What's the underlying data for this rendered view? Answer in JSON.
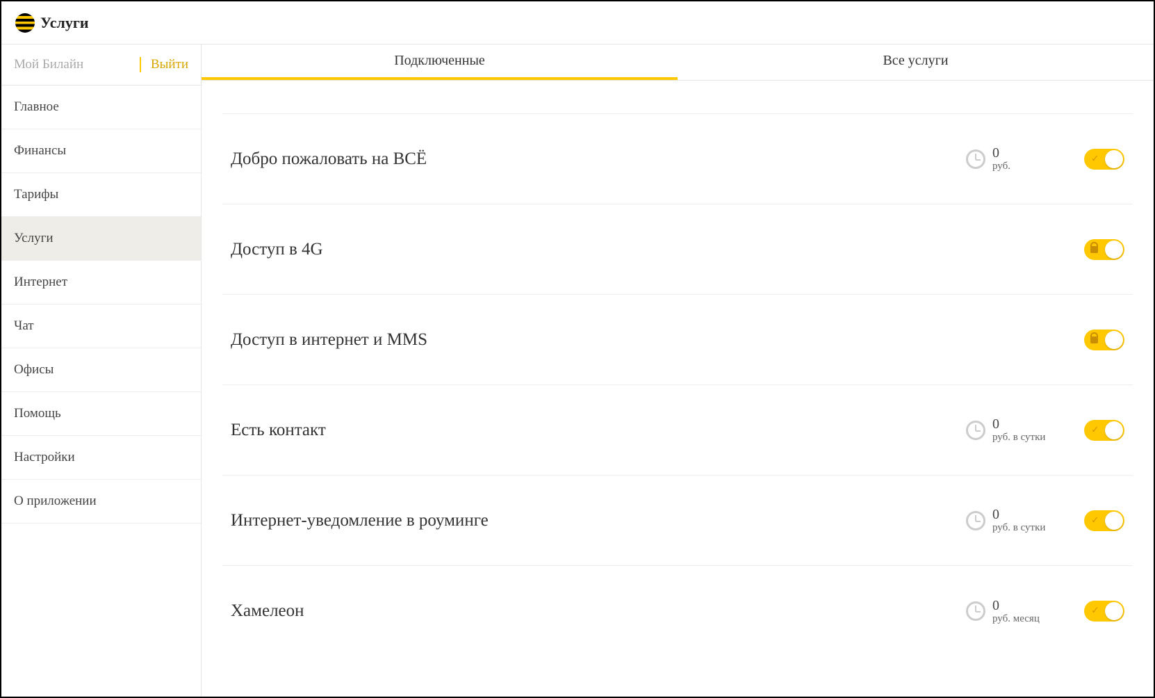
{
  "header": {
    "title": "Услуги"
  },
  "sidebar": {
    "account_label": "Мой Билайн",
    "logout_label": "Выйти",
    "items": [
      {
        "label": "Главное",
        "active": false
      },
      {
        "label": "Финансы",
        "active": false
      },
      {
        "label": "Тарифы",
        "active": false
      },
      {
        "label": "Услуги",
        "active": true
      },
      {
        "label": "Интернет",
        "active": false
      },
      {
        "label": "Чат",
        "active": false
      },
      {
        "label": "Офисы",
        "active": false
      },
      {
        "label": "Помощь",
        "active": false
      },
      {
        "label": "Настройки",
        "active": false
      },
      {
        "label": "О приложении",
        "active": false
      }
    ]
  },
  "tabs": [
    {
      "label": "Подключенные",
      "active": true
    },
    {
      "label": "Все услуги",
      "active": false
    }
  ],
  "services": [
    {
      "title": "Добро пожаловать на ВСЁ",
      "price_value": "0",
      "price_unit": "руб.",
      "show_price": true,
      "toggle_mark": "check"
    },
    {
      "title": "Доступ в 4G",
      "show_price": false,
      "toggle_mark": "lock"
    },
    {
      "title": "Доступ в интернет и MMS",
      "show_price": false,
      "toggle_mark": "lock"
    },
    {
      "title": "Есть контакт",
      "price_value": "0",
      "price_unit": "руб. в сутки",
      "show_price": true,
      "toggle_mark": "check"
    },
    {
      "title": "Интернет-уведомление в роуминге",
      "price_value": "0",
      "price_unit": "руб. в сутки",
      "show_price": true,
      "toggle_mark": "check"
    },
    {
      "title": "Хамелеон",
      "price_value": "0",
      "price_unit": "руб. месяц",
      "show_price": true,
      "toggle_mark": "check"
    }
  ]
}
